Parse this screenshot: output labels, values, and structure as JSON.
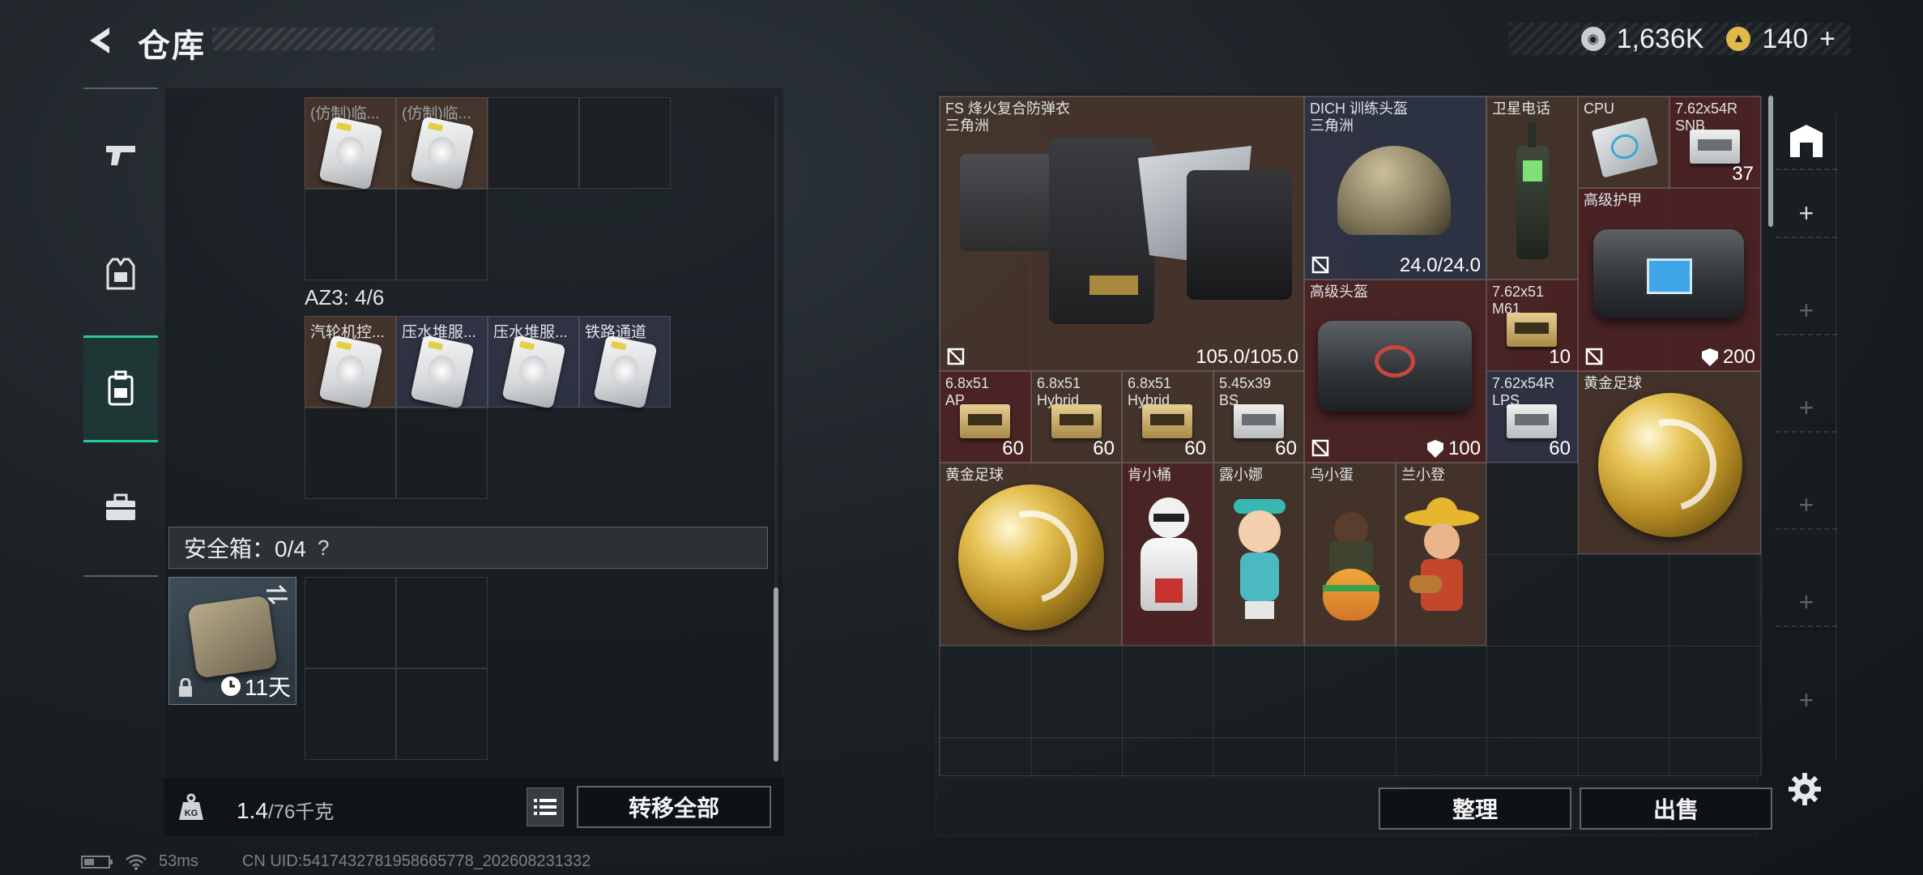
{
  "header": {
    "title": "仓库",
    "currency": [
      {
        "icon": "silver-coin-icon",
        "value": "1,636K",
        "color": "#c9ced2"
      },
      {
        "icon": "gold-coin-icon",
        "value": "140",
        "color": "#e2b84a"
      }
    ],
    "add_symbol": "+"
  },
  "side_nav": [
    {
      "name": "weapons-tab",
      "icon": "pistol-icon",
      "active": false
    },
    {
      "name": "equipment-tab",
      "icon": "vest-icon",
      "active": false
    },
    {
      "name": "backpack-tab",
      "icon": "backpack-icon",
      "active": true
    },
    {
      "name": "toolbox-tab",
      "icon": "toolbox-icon",
      "active": false
    }
  ],
  "left": {
    "top_items": [
      {
        "label": "(仿制)临...",
        "color": "brown"
      },
      {
        "label": "(仿制)临...",
        "color": "brown"
      }
    ],
    "az3_label": "AZ3: 4/6",
    "az3_items": [
      {
        "label": "汽轮机控...",
        "color": "brown"
      },
      {
        "label": "压水堆服...",
        "color": "navy"
      },
      {
        "label": "压水堆服...",
        "color": "navy"
      },
      {
        "label": "铁路通道",
        "color": "navy"
      }
    ],
    "safe_box_label": "安全箱：0/4",
    "help_symbol": "?",
    "safe_item_days": "11天",
    "weight_current": "1.4",
    "weight_max": "/76千克",
    "transfer_all": "转移全部"
  },
  "right": {
    "items": [
      {
        "id": "vest",
        "label": "FS 烽火复合防弹衣\n三角洲",
        "durability": "105.0/105.0",
        "color": "brown"
      },
      {
        "id": "helmet1",
        "label": "DICH 训练头盔\n三角洲",
        "durability": "24.0/24.0",
        "color": "navy"
      },
      {
        "id": "sat-phone",
        "label": "卫星电话",
        "color": "brown"
      },
      {
        "id": "cpu",
        "label": "CPU",
        "color": "brown"
      },
      {
        "id": "ammo-762r-1",
        "label": "7.62x54R\nSNB",
        "count": "37",
        "color": "red"
      },
      {
        "id": "armor-bag",
        "label": "高级护甲",
        "count": "200",
        "color": "red"
      },
      {
        "id": "helmet-bag",
        "label": "高级头盔",
        "count": "100",
        "color": "red"
      },
      {
        "id": "ammo-762-m61",
        "label": "7.62x51\nM61",
        "count": "10",
        "color": "red"
      },
      {
        "id": "ammo-68-ap",
        "label": "6.8x51\nAP",
        "count": "60",
        "color": "red"
      },
      {
        "id": "ammo-68-hyb1",
        "label": "6.8x51\nHybrid",
        "count": "60",
        "color": "brown"
      },
      {
        "id": "ammo-68-hyb2",
        "label": "6.8x51\nHybrid",
        "count": "60",
        "color": "brown"
      },
      {
        "id": "ammo-545-bs",
        "label": "5.45x39\nBS",
        "count": "60",
        "color": "brown"
      },
      {
        "id": "ammo-762r-2",
        "label": "7.62x54R\nLPS",
        "count": "60",
        "color": "navy"
      },
      {
        "id": "ball-1",
        "label": "黄金足球",
        "color": "brown"
      },
      {
        "id": "ball-2",
        "label": "黄金足球",
        "color": "brown"
      },
      {
        "id": "fig-1",
        "label": "肯小桶",
        "color": "red"
      },
      {
        "id": "fig-2",
        "label": "露小娜",
        "color": "brown"
      },
      {
        "id": "fig-3",
        "label": "乌小蛋",
        "color": "brown"
      },
      {
        "id": "fig-4",
        "label": "兰小登",
        "color": "brown"
      }
    ],
    "sort_btn": "整理",
    "sell_btn": "出售"
  },
  "status": {
    "ping": "53ms",
    "uid": "CN UID:5417432781958665778_202608231332"
  },
  "colors": {
    "accent": "#29c7a0",
    "brown": "#503a2e",
    "red": "#5a2626",
    "navy": "#34384e"
  }
}
